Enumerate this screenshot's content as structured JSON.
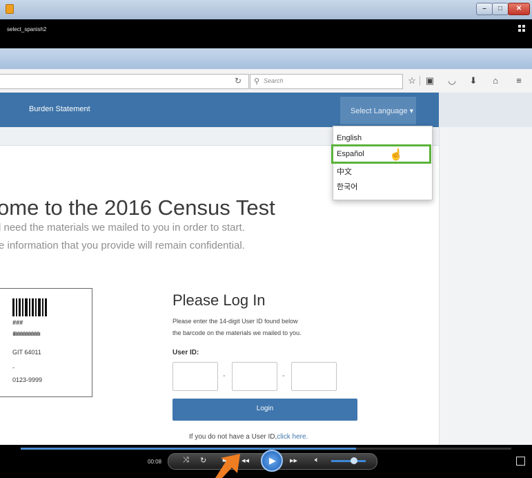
{
  "window": {
    "video_title": "select_spanish2"
  },
  "browser": {
    "search_placeholder": "Search",
    "toolbar_icons": [
      "star-icon",
      "clipboard-icon",
      "pocket-icon",
      "download-icon",
      "home-icon",
      "menu-icon"
    ]
  },
  "site": {
    "nav": {
      "burden": "Burden Statement",
      "select_language": "Select Language ▾"
    },
    "language_menu": [
      "English",
      "Español",
      "中文",
      "한국어"
    ],
    "heading": "ome to the 2016 Census Test",
    "sub1": "l need the materials we mailed to you in order to start.",
    "sub2": "e information that you provide will remain confidential.",
    "card": {
      "line1": "###",
      "line2": "GIT 64011",
      "line3": "-",
      "line4": "0123-9999"
    },
    "login": {
      "title": "Please Log In",
      "desc1": "Please enter the 14-digit User ID found below",
      "desc2": "the barcode on the materials we mailed to you.",
      "userid_label": "User ID:",
      "dash": "-",
      "button": "Login",
      "no_id_text": "If you do not have a User ID,",
      "no_id_link": "click here."
    }
  },
  "player": {
    "time": "00:08"
  },
  "colors": {
    "accent": "#3f76ad",
    "highlight": "#5ab33b",
    "arrow": "#ef7d22"
  }
}
